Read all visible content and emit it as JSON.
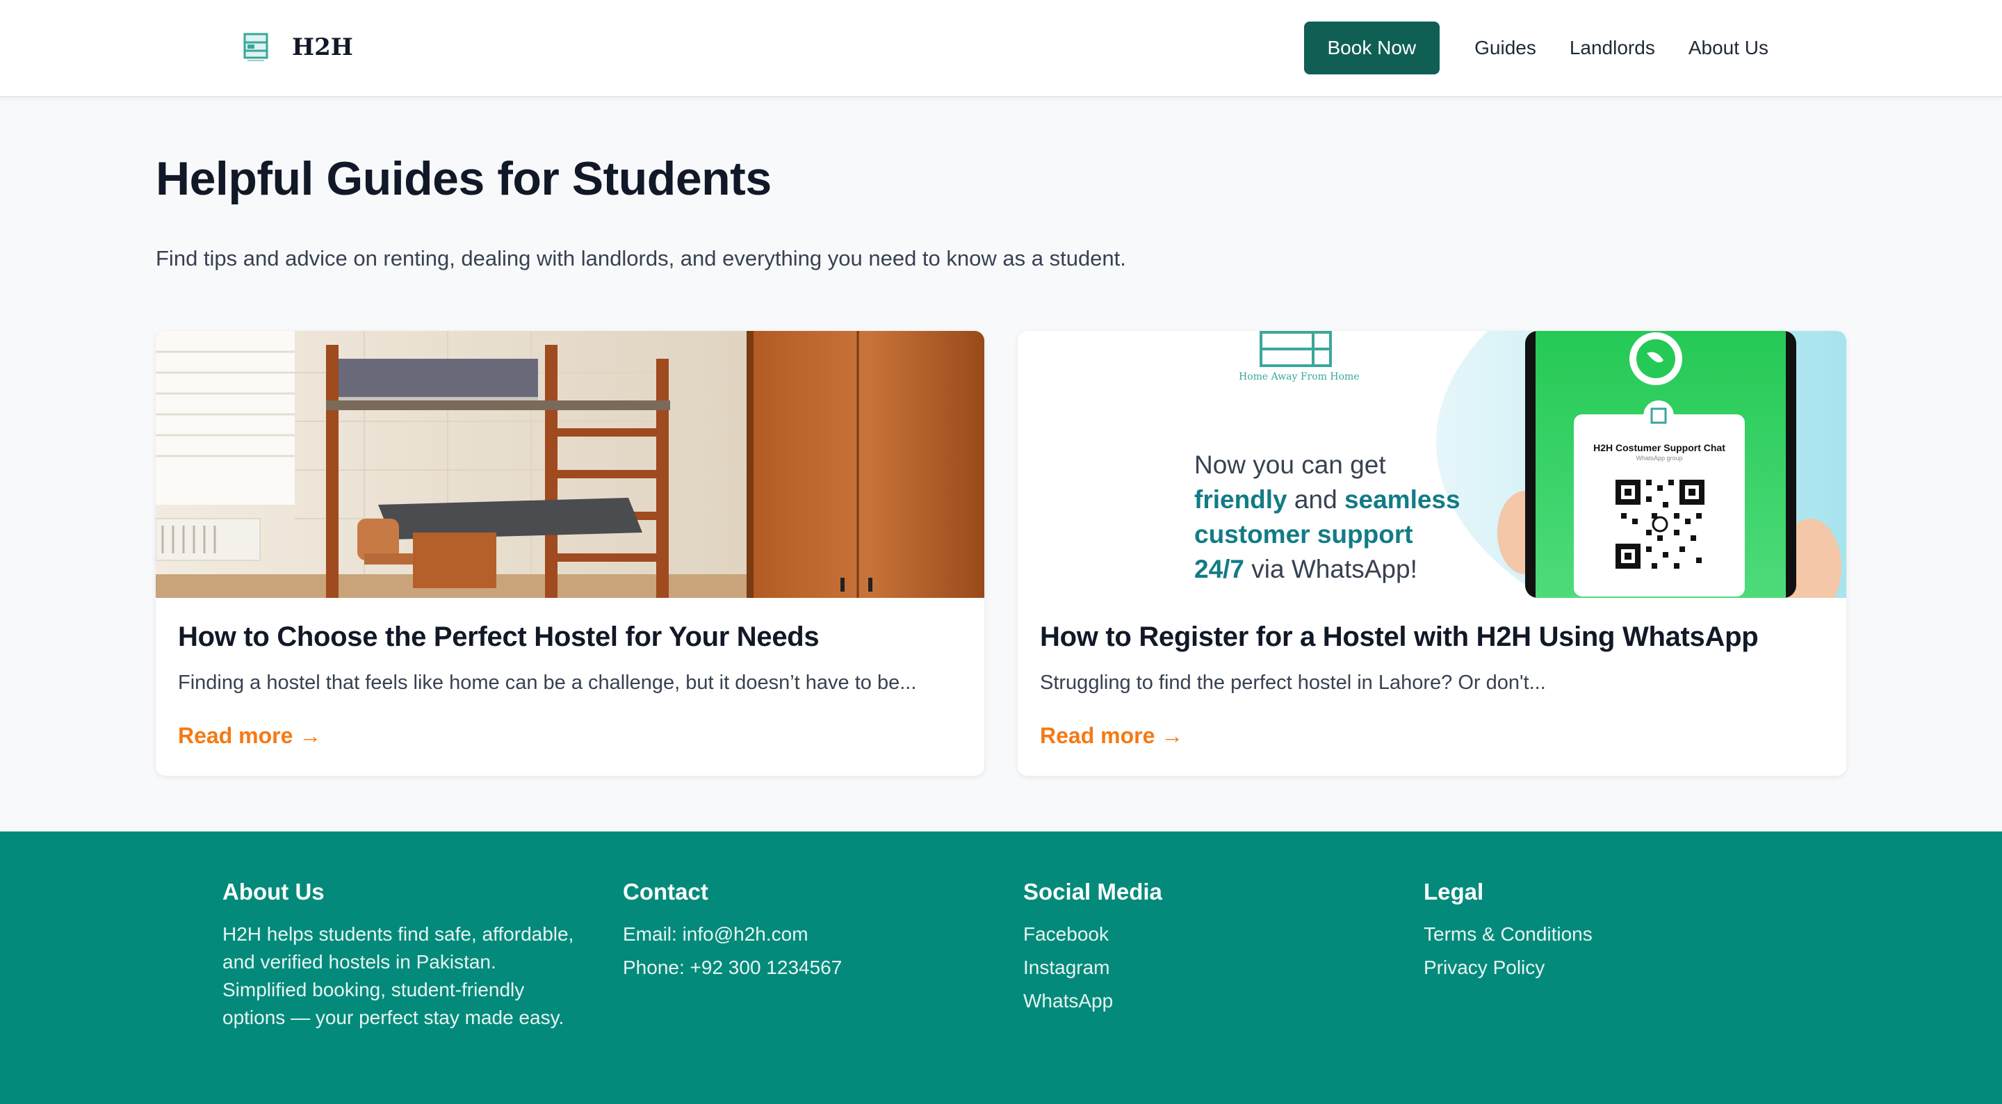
{
  "header": {
    "brand": "H2H",
    "logo_icon": "hostel-bed-logo",
    "book_label": "Book Now",
    "nav": [
      "Guides",
      "Landlords",
      "About Us"
    ]
  },
  "hero": {
    "title": "Helpful Guides for Students",
    "subtitle": "Find tips and advice on renting, dealing with landlords, and everything you need to know as a student."
  },
  "cards": [
    {
      "title": "How to Choose the Perfect Hostel for Your Needs",
      "excerpt": "Finding a hostel that feels like home can be a challenge, but it doesn’t have to be...",
      "link": "Read more →"
    },
    {
      "title": "How to Register for a Hostel with H2H Using WhatsApp",
      "excerpt": "Struggling to find the perfect hostel in Lahore? Or don't...",
      "link": "Read more →",
      "banner": {
        "tagline": "Home Away From Home",
        "line1": "Now you can get",
        "hl1": "friendly",
        "and": "and",
        "hl2": "seamless",
        "hl3": "customer support",
        "hl4": "24/7",
        "line_end": "via WhatsApp!",
        "chat_title": "H2H Costumer Support Chat",
        "chat_sub": "WhatsApp group"
      }
    }
  ],
  "footer": {
    "about": {
      "heading": "About Us",
      "text": "H2H helps students find safe, affordable, and verified hostels in Pakistan. Simplified booking, student-friendly options — your perfect stay made easy."
    },
    "contact": {
      "heading": "Contact",
      "email": "Email: info@h2h.com",
      "phone": "Phone: +92 300 1234567"
    },
    "social": {
      "heading": "Social Media",
      "links": [
        "Facebook",
        "Instagram",
        "WhatsApp"
      ]
    },
    "legal": {
      "heading": "Legal",
      "links": [
        "Terms & Conditions",
        "Privacy Policy"
      ]
    }
  },
  "colors": {
    "brand": "#0f5f55",
    "footer": "#048a7b",
    "accent": "#f47a14"
  }
}
